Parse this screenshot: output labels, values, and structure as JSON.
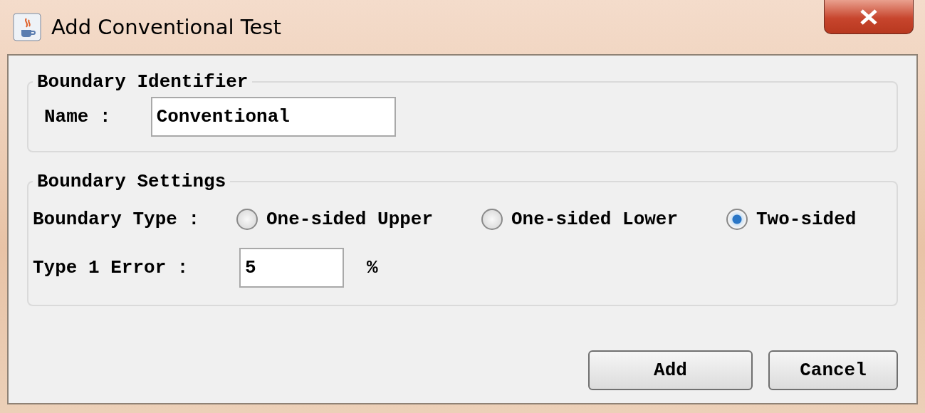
{
  "window": {
    "title": "Add Conventional Test"
  },
  "identifier": {
    "legend": "Boundary Identifier",
    "name_label": "Name :",
    "name_value": "Conventional"
  },
  "settings": {
    "legend": "Boundary Settings",
    "type_label": "Boundary Type :",
    "types": [
      {
        "label": "One-sided Upper",
        "selected": false
      },
      {
        "label": "One-sided Lower",
        "selected": false
      },
      {
        "label": "Two-sided",
        "selected": true
      }
    ],
    "error_label": "Type 1 Error :",
    "error_value": "5",
    "error_unit": "%"
  },
  "buttons": [
    "Add",
    "Cancel"
  ]
}
